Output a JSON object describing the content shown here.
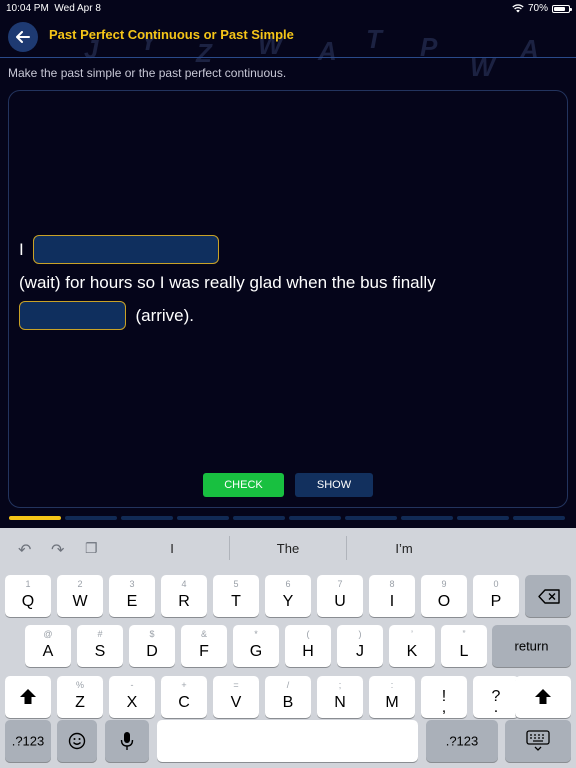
{
  "status_bar": {
    "time": "10:04 PM",
    "date": "Wed Apr 8",
    "battery": "70%",
    "battery_level": 0.7
  },
  "header": {
    "title": "Past Perfect Continuous or Past Simple",
    "back_icon": "arrow-left-icon"
  },
  "instruction": "Make the past simple or the past perfect continuous.",
  "exercise": {
    "subject": "I",
    "mid_text": "(wait) for hours so I was really glad when the bus finally",
    "end_text": "(arrive).",
    "blank1_value": "",
    "blank2_value": ""
  },
  "buttons": {
    "check": "CHECK",
    "show": "SHOW"
  },
  "progress": {
    "total": 10,
    "current": 1
  },
  "keyboard": {
    "suggestions": [
      "I",
      "The",
      "I’m"
    ],
    "row1": [
      {
        "k": "Q",
        "h": "1"
      },
      {
        "k": "W",
        "h": "2"
      },
      {
        "k": "E",
        "h": "3"
      },
      {
        "k": "R",
        "h": "4"
      },
      {
        "k": "T",
        "h": "5"
      },
      {
        "k": "Y",
        "h": "6"
      },
      {
        "k": "U",
        "h": "7"
      },
      {
        "k": "I",
        "h": "8"
      },
      {
        "k": "O",
        "h": "9"
      },
      {
        "k": "P",
        "h": "0"
      }
    ],
    "row2": [
      {
        "k": "A",
        "h": "@"
      },
      {
        "k": "S",
        "h": "#"
      },
      {
        "k": "D",
        "h": "$"
      },
      {
        "k": "F",
        "h": "&"
      },
      {
        "k": "G",
        "h": "*"
      },
      {
        "k": "H",
        "h": "("
      },
      {
        "k": "J",
        "h": ")"
      },
      {
        "k": "K",
        "h": "’"
      },
      {
        "k": "L",
        "h": "”"
      }
    ],
    "row3": [
      {
        "k": "Z",
        "h": "%"
      },
      {
        "k": "X",
        "h": "-"
      },
      {
        "k": "C",
        "h": "+"
      },
      {
        "k": "V",
        "h": "="
      },
      {
        "k": "B",
        "h": "/"
      },
      {
        "k": "N",
        "h": ";"
      },
      {
        "k": "M",
        "h": ":"
      },
      {
        "k": "!\n,",
        "h": ""
      },
      {
        "k": "?\n.",
        "h": ""
      }
    ],
    "return_label": "return",
    "numbers_label": ".?123"
  },
  "colors": {
    "accent": "#f5c518",
    "check": "#18c040",
    "show": "#12305e",
    "background": "#05051a"
  }
}
